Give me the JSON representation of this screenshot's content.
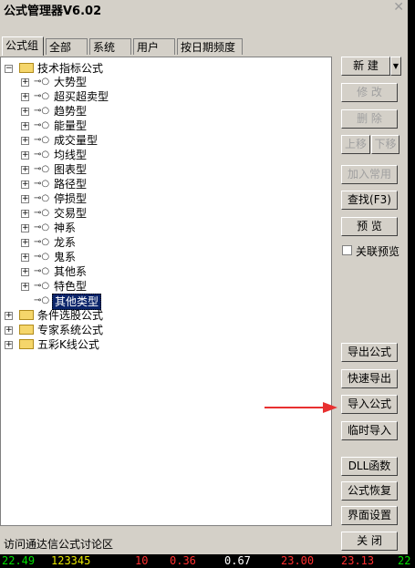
{
  "window": {
    "title": "公式管理器V6.02"
  },
  "tabs": [
    {
      "label": "公式组",
      "active": true
    },
    {
      "label": "全部",
      "active": false
    },
    {
      "label": "系统",
      "active": false
    },
    {
      "label": "用户",
      "active": false
    },
    {
      "label": "按日期频度",
      "active": false
    }
  ],
  "tree": {
    "root1": "技术指标公式",
    "children": [
      "大势型",
      "超买超卖型",
      "趋势型",
      "能量型",
      "成交量型",
      "均线型",
      "图表型",
      "路径型",
      "停损型",
      "交易型",
      "神系",
      "龙系",
      "鬼系",
      "其他系",
      "特色型",
      "其他类型"
    ],
    "selected": "其他类型",
    "root2": "条件选股公式",
    "root3": "专家系统公式",
    "root4": "五彩K线公式"
  },
  "buttons": {
    "new": "新 建",
    "new_arrow": "▼",
    "modify": "修 改",
    "delete": "删 除",
    "move_up": "上移",
    "move_down": "下移",
    "add_common": "加入常用",
    "find": "查找(F3)",
    "preview": "预 览",
    "export": "导出公式",
    "quick_export": "快速导出",
    "import": "导入公式",
    "temp_import": "临时导入",
    "dll": "DLL函数",
    "restore": "公式恢复",
    "ui_settings": "界面设置",
    "close": "关 闭"
  },
  "link_preview_label": "关联预览",
  "status_link": "访问通达信公式讨论区",
  "ticker": [
    "22.49",
    "123345",
    "10",
    "0.36",
    "0.67",
    "23.00",
    "23.13",
    "22"
  ],
  "colors": {
    "green": "#00e000",
    "yellow": "#e8e800",
    "red": "#ff3030",
    "white": "#ffffff",
    "arrow": "#e83030"
  }
}
